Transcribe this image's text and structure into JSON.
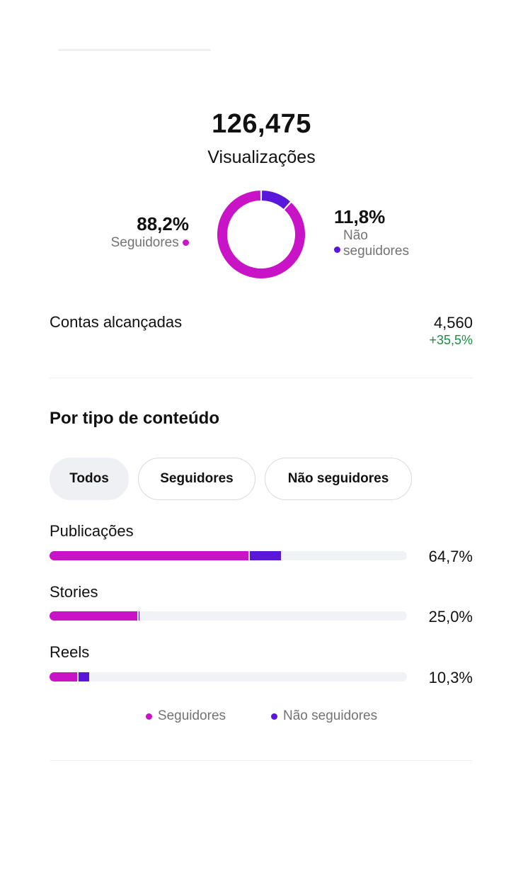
{
  "colors": {
    "followers": "#c913c6",
    "non_followers": "#5b17d9",
    "positive": "#1a8f3e",
    "track": "#f1f2f5"
  },
  "summary": {
    "total_views": "126,475",
    "total_views_label": "Visualizações"
  },
  "audience_split": {
    "followers": {
      "percent_text": "88,2%",
      "label": "Seguidores",
      "value": 88.2
    },
    "non_followers": {
      "percent_text": "11,8%",
      "label": "Não seguidores",
      "value": 11.8
    }
  },
  "reach": {
    "label": "Contas alcançadas",
    "value": "4,560",
    "change": "+35,5%"
  },
  "content_type": {
    "title": "Por tipo de conteúdo",
    "tabs": [
      {
        "label": "Todos",
        "active": true
      },
      {
        "label": "Seguidores",
        "active": false
      },
      {
        "label": "Não seguidores",
        "active": false
      }
    ],
    "rows": [
      {
        "label": "Publicações",
        "percent_text": "64,7%",
        "followers_share": 55.6,
        "non_followers_share": 9.1
      },
      {
        "label": "Stories",
        "percent_text": "25,0%",
        "followers_share": 24.6,
        "non_followers_share": 0.6
      },
      {
        "label": "Reels",
        "percent_text": "10,3%",
        "followers_share": 7.7,
        "non_followers_share": 3.3
      }
    ],
    "legend": {
      "followers": "Seguidores",
      "non_followers": "Não seguidores"
    }
  }
}
